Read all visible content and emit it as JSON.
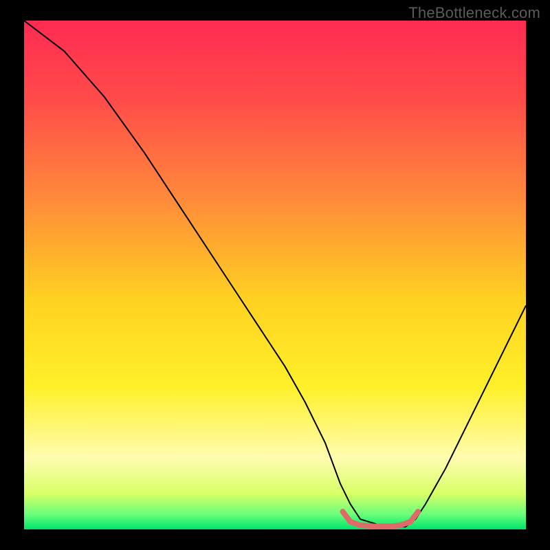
{
  "watermark": "TheBottleneck.com",
  "chart_data": {
    "type": "line",
    "title": "",
    "xlabel": "",
    "ylabel": "",
    "xlim": [
      0,
      100
    ],
    "ylim": [
      0,
      100
    ],
    "grid": false,
    "legend": false,
    "background_gradient": {
      "stops": [
        {
          "offset": 0.0,
          "color": "#ff2b52"
        },
        {
          "offset": 0.15,
          "color": "#ff4a4a"
        },
        {
          "offset": 0.35,
          "color": "#ff8a3a"
        },
        {
          "offset": 0.55,
          "color": "#ffd221"
        },
        {
          "offset": 0.72,
          "color": "#fff02a"
        },
        {
          "offset": 0.86,
          "color": "#fffcb0"
        },
        {
          "offset": 0.93,
          "color": "#d7ff66"
        },
        {
          "offset": 0.97,
          "color": "#6bff7a"
        },
        {
          "offset": 1.0,
          "color": "#00e56a"
        }
      ]
    },
    "series": [
      {
        "name": "bottleneck-curve",
        "stroke": "#000000",
        "stroke_width": 2,
        "x": [
          0,
          4,
          8,
          16,
          24,
          32,
          40,
          48,
          52,
          56,
          60,
          63,
          65,
          67,
          72,
          76,
          78,
          80,
          84,
          90,
          96,
          100
        ],
        "y": [
          100,
          97,
          94,
          85,
          74,
          62,
          50,
          38,
          32,
          25,
          17,
          9,
          5,
          2,
          0.5,
          0.5,
          2,
          5,
          12,
          24,
          36,
          44
        ]
      },
      {
        "name": "optimal-band",
        "stroke": "#e06a6a",
        "stroke_width": 8,
        "x": [
          63.5,
          65,
          67,
          70,
          73,
          75,
          77,
          78.5
        ],
        "y": [
          3.5,
          1.5,
          0.8,
          0.6,
          0.6,
          0.8,
          1.5,
          3.5
        ]
      }
    ]
  }
}
